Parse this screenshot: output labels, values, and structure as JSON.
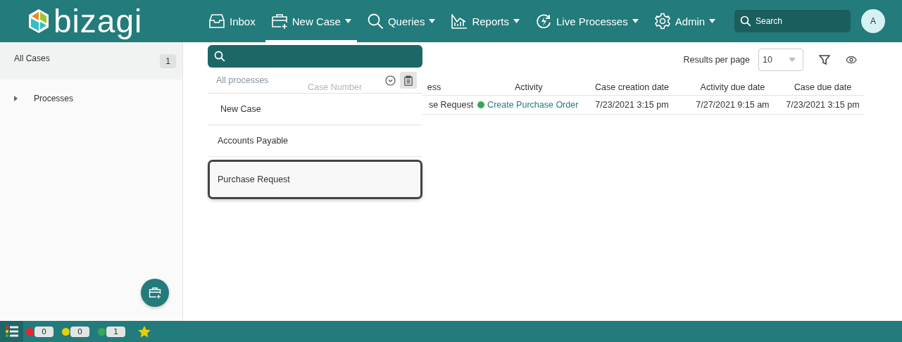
{
  "header": {
    "logo": "bizagi",
    "nav": [
      {
        "label": "Inbox",
        "dropdown": false,
        "selected": false
      },
      {
        "label": "New Case",
        "dropdown": true,
        "selected": true
      },
      {
        "label": "Queries",
        "dropdown": true,
        "selected": false
      },
      {
        "label": "Reports",
        "dropdown": true,
        "selected": false
      },
      {
        "label": "Live Processes",
        "dropdown": true,
        "selected": false
      },
      {
        "label": "Admin",
        "dropdown": true,
        "selected": false
      }
    ],
    "search": {
      "placeholder": "Search"
    },
    "avatar": "A"
  },
  "sidebar": {
    "items": [
      {
        "label": "All Cases",
        "count": "1",
        "selected": true,
        "expandable": false
      },
      {
        "label": "Processes",
        "selected": false,
        "expandable": true,
        "expanded": false
      }
    ]
  },
  "toolbar": {
    "results_label": "Results per page",
    "results_value": "10"
  },
  "table": {
    "columns": [
      "Case Number",
      "ess",
      "Activity",
      "Case creation date",
      "Activity due date",
      "Case due date"
    ],
    "rows": [
      {
        "column_2": "se Request",
        "activity": "Create Purchase Order",
        "color": "#3aa55a",
        "creation": "7/23/2021 3:15 pm",
        "activity_due": "7/27/2021 9:15 am",
        "case_due": "7/23/2021 3:15 pm"
      }
    ]
  },
  "new_case_menu": {
    "filter": "All processes",
    "items": [
      {
        "label": "New Case",
        "kind": "header",
        "selected": false
      },
      {
        "label": "Accounts Payable",
        "kind": "process",
        "selected": false
      },
      {
        "label": "Purchase Request",
        "kind": "process",
        "selected": true
      }
    ]
  },
  "status_bar": {
    "counters": [
      {
        "color": "#e8262b",
        "count": "0"
      },
      {
        "color": "#e6d000",
        "count": "0"
      },
      {
        "color": "#3aa55a",
        "count": "1"
      }
    ]
  }
}
